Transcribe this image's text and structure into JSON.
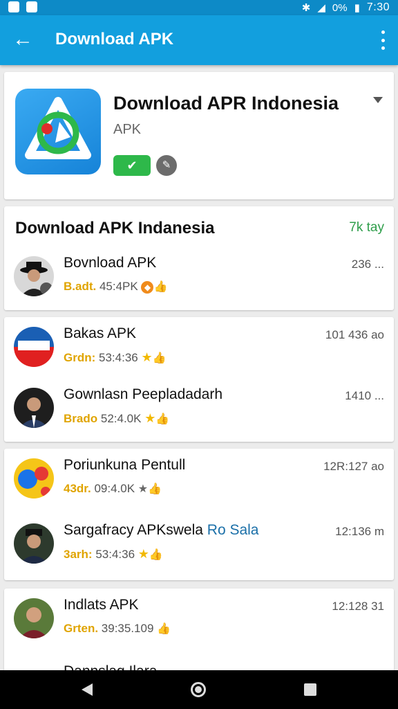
{
  "status_bar": {
    "battery": "0%",
    "time": "7:30"
  },
  "app_bar": {
    "title": "Download APK"
  },
  "header": {
    "title": "Download APR Indonesia",
    "subtitle": "APK"
  },
  "section": {
    "title": "Download APK Indanesia",
    "meta": "7k tay"
  },
  "rows": [
    {
      "name": "Bovnload APK",
      "tag": "B.adt.",
      "sub": "45:4PK",
      "meta": "236 ..."
    },
    {
      "name": "Bakas APK",
      "tag": "Grdn:",
      "sub": "53:4:36",
      "meta": "101 436 ao"
    },
    {
      "name": "Gownlasn Peepladadarh",
      "tag": "Brado",
      "sub": "52:4.0K",
      "meta": "1410 ..."
    },
    {
      "name": "Poriunkuna Pentull",
      "tag": "43dr.",
      "sub": "09:4.0K",
      "meta": "12R:127 ao"
    },
    {
      "name": "Sargafracy APKswela",
      "name_highlight": "Ro Sala",
      "tag": "3arh:",
      "sub": "53:4:36",
      "meta": "12:136 m"
    },
    {
      "name": "Indlats APK",
      "tag": "Grten.",
      "sub": "39:35.109",
      "meta": "12:128 31"
    },
    {
      "name": "Dannslag Ilara"
    }
  ]
}
